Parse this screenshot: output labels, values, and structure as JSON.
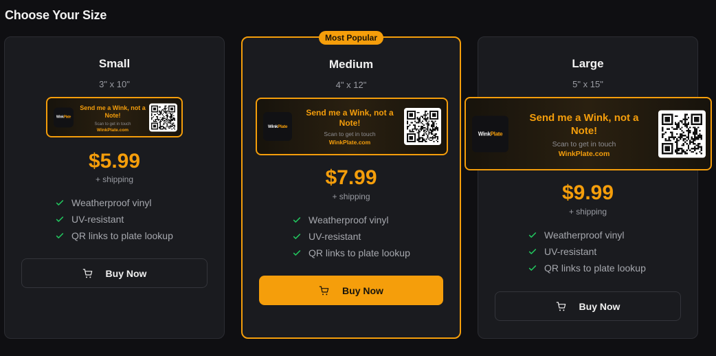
{
  "heading": "Choose Your Size",
  "badge": "Most Popular",
  "preview": {
    "title": "Send me a Wink, not a Note!",
    "subtitle": "Scan to get in touch",
    "url": "WinkPlate.com",
    "logo": "WinkPlate"
  },
  "features": [
    "Weatherproof vinyl",
    "UV-resistant",
    "QR links to plate lookup"
  ],
  "cards": [
    {
      "name": "Small",
      "dims": "3\" x 10\"",
      "price": "$5.99",
      "shipping": "+ shipping",
      "button": "Buy Now"
    },
    {
      "name": "Medium",
      "dims": "4\" x 12\"",
      "price": "$7.99",
      "shipping": "+ shipping",
      "button": "Buy Now"
    },
    {
      "name": "Large",
      "dims": "5\" x 15\"",
      "price": "$9.99",
      "shipping": "+ shipping",
      "button": "Buy Now"
    }
  ],
  "colors": {
    "accent": "#f59e0b",
    "card_bg": "#1a1b1f",
    "page_bg": "#0f0f12",
    "check": "#22c55e"
  },
  "icons": {
    "check": "check-icon",
    "cart": "cart-icon",
    "qr": "qr-code-icon"
  }
}
